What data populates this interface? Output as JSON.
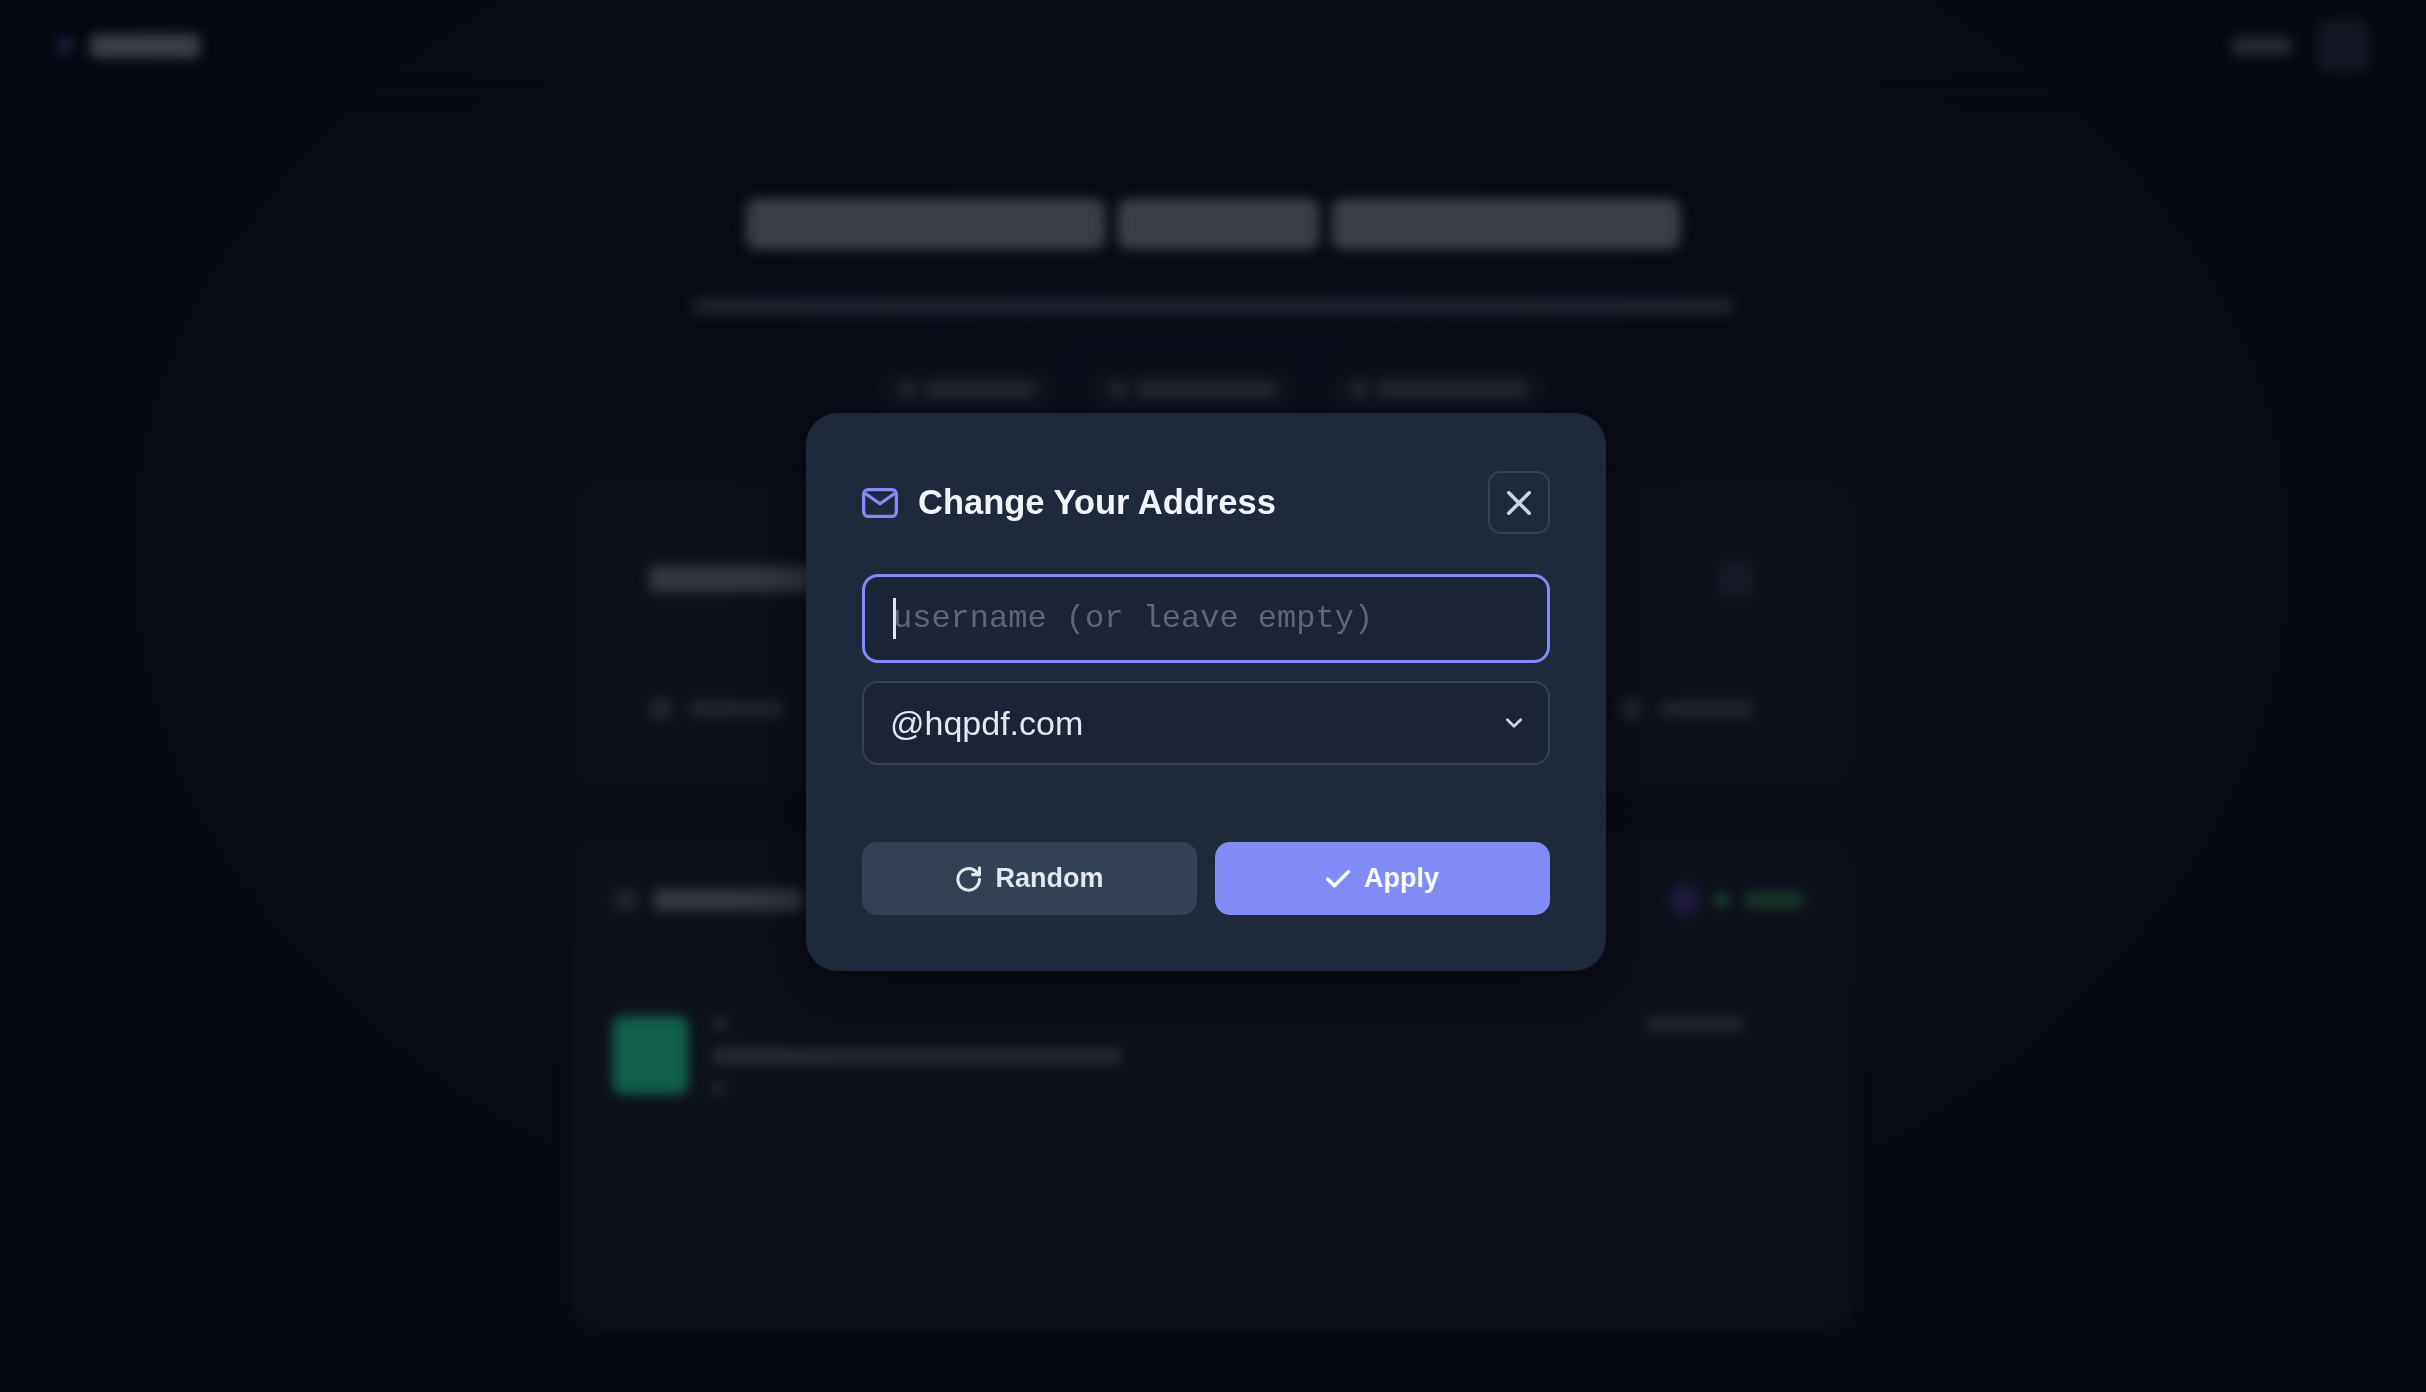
{
  "dialog": {
    "title": "Change Your Address",
    "username_field": {
      "placeholder": "username (or leave empty)",
      "focused": true
    },
    "domain_select": {
      "value": "@hqpdf.com"
    },
    "buttons": [
      {
        "label": "Random",
        "kind": "secondary"
      },
      {
        "label": "Apply",
        "kind": "primary"
      }
    ]
  }
}
